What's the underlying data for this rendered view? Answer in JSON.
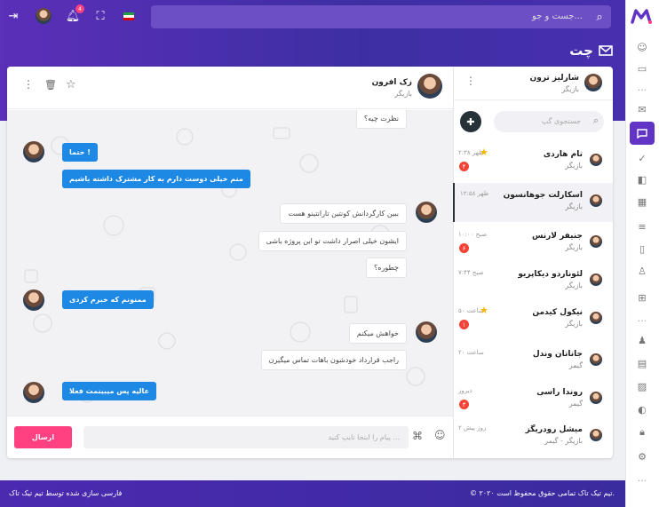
{
  "header": {
    "search_placeholder": "جست و جو...",
    "notifications_count": "4",
    "page_title": "چت"
  },
  "sidebar": {
    "user": {
      "name": "شارلیز ترون",
      "role": "بازیگر"
    },
    "search_placeholder": "جستجوی گپ",
    "contacts": [
      {
        "name": "تام هاردی",
        "role": "بازیگر",
        "time": "۲:۳۸ ظهر",
        "starred": true,
        "unread": "۴"
      },
      {
        "name": "اسکارلت جوهانسون",
        "role": "بازیگر",
        "time": "۱۲:۵۸ ظهر",
        "starred": false,
        "unread": ""
      },
      {
        "name": "جنیفر لارنس",
        "role": "بازیگر",
        "time": "۱۰:۰۰ صبح",
        "starred": false,
        "unread": "۶"
      },
      {
        "name": "لئوناردو دیکاپریو",
        "role": "بازیگر",
        "time": "۷:۴۴ صبح",
        "starred": false,
        "unread": ""
      },
      {
        "name": "نیکول کیدمن",
        "role": "بازیگر",
        "time": "۵۰ ساعت",
        "starred": true,
        "unread": "۱"
      },
      {
        "name": "جاناتان وندل",
        "role": "گیمر",
        "time": "۲۰ ساعت",
        "starred": false,
        "unread": ""
      },
      {
        "name": "روندا راسی",
        "role": "گیمر",
        "time": "دیروز",
        "starred": false,
        "unread": "۳"
      },
      {
        "name": "میشل رودریگز",
        "role": "بازیگر - گیمر",
        "time": "۲ روز پیش",
        "starred": false,
        "unread": ""
      }
    ]
  },
  "chat": {
    "contact": {
      "name": "زک افرون",
      "role": "بازیگر"
    },
    "messages": [
      {
        "side": "right",
        "text": "نظرت چیه؟"
      },
      {
        "side": "left",
        "text": "حتما !"
      },
      {
        "side": "left",
        "text": "منم خیلی دوست دارم به کار مشترک داشته باشیم"
      },
      {
        "side": "right",
        "text": "ببین کارگردانش کونتین تارانتینو هست"
      },
      {
        "side": "right",
        "text": "ایشون خیلی اصرار داشت تو این پروژه باشی"
      },
      {
        "side": "right",
        "text": "چطوره؟"
      },
      {
        "side": "left",
        "text": "ممنونم که خبرم کردی"
      },
      {
        "side": "right",
        "text": "خواهش میکنم"
      },
      {
        "side": "right",
        "text": "راجب قرارداد خودشون باهات تماس میگیرن"
      },
      {
        "side": "left",
        "text": "عالیه پس میبینمت فعلا"
      }
    ],
    "input_placeholder": "پیام را اینجا تایپ کنید ...",
    "send_label": "ارسال"
  },
  "footer": {
    "copyright": "© ۲۰۲۰ تیم تیک تاک تمامی حقوق محفوظ است.",
    "credit": "فارسی سازی شده توسط تیم تیک تاک"
  },
  "colors": {
    "primary": "#5b2fb8",
    "accent": "#ff4081",
    "bubble": "#1e88e5",
    "unread": "#f44336"
  }
}
